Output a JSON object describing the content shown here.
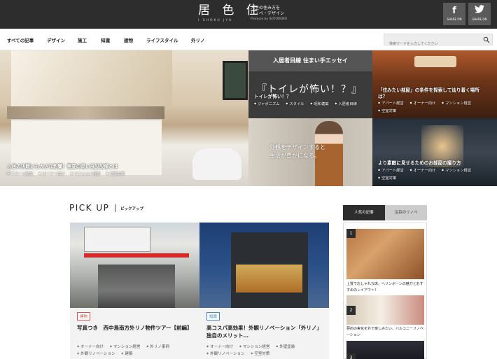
{
  "header": {
    "logo_mark": "居 色 住",
    "logo_sub": "I SHOKU JYU",
    "tagline_line1": "人生の住み方を",
    "tagline_line2": "リノベ・デザイン",
    "tagline_produce": "Produce by SOTORENO",
    "social": [
      {
        "glyph": "f",
        "label": "SHARE ON"
      },
      {
        "glyph": "t",
        "label": "SHARE ON"
      }
    ]
  },
  "nav": {
    "items": [
      "すべての記事",
      "デザイン",
      "施工",
      "知識",
      "建物",
      "ライフスタイル",
      "外リノ"
    ],
    "search_placeholder": "検索ワードを入力してください"
  },
  "hero": {
    "main": {
      "title": "入居の決断にも大きな影響！需要の高い施設設備とは",
      "tags": [
        "アパート経営",
        "オーナー向け",
        "マンション経営",
        "空室対策"
      ]
    },
    "toilet": {
      "band_title": "入居者目線 住まい手エッセイ",
      "big_text": "『トイレが怖い！？』",
      "title": "トイレが怖い！？",
      "tags": [
        "ジャポニズム",
        "スタイル",
        "昭和建築",
        "入居者目線"
      ]
    },
    "room1": {
      "title": "「住みたい部屋」の条件を探索して辿り着く場所は？",
      "title_line1": "「住みたい部屋」の条件を探索して辿り着く場所",
      "title_line2": "は？",
      "tags": [
        "アパート経営",
        "オーナー向け",
        "マンション経営",
        "空室対策"
      ]
    },
    "woman": {
      "caption_line1": "外観をデザインすると",
      "caption_line2": "生活が豊かになる。"
    },
    "room2": {
      "title": "より素敵に見せるためのお部屋の撮り方",
      "tags": [
        "アパート経営",
        "オーナー向け",
        "マンション経営",
        "空室対策"
      ]
    }
  },
  "pickup": {
    "heading": "PICK UP",
    "subheading": "ピックアップ",
    "cards": [
      {
        "category": "建物",
        "title": "写真つき　西中島南方外リノ物件ツアー【前編】",
        "tags": [
          "オーナー向け",
          "マンション経営",
          "外リノ事例",
          "外観リノベーション",
          "建築"
        ]
      },
      {
        "category": "知識",
        "title": "高コスパ高効果！外観リノベーション「外リノ」独自のメリット…",
        "tags": [
          "オーナー向け",
          "マンション経営",
          "外壁塗装",
          "外観リノベーション",
          "空室対策"
        ]
      }
    ]
  },
  "sidebar": {
    "tabs": [
      "人気の記事",
      "注目のリノベ"
    ],
    "items": [
      {
        "rank": "1",
        "text": "上質でおしゃれな床。ヘリンボーンの魅力とおすすめのレイアウト！"
      },
      {
        "rank": "2",
        "text": "夢的の実化を外で楽しみたい。バルコニーリノベーション"
      },
      {
        "rank": "3",
        "text": ""
      }
    ]
  }
}
